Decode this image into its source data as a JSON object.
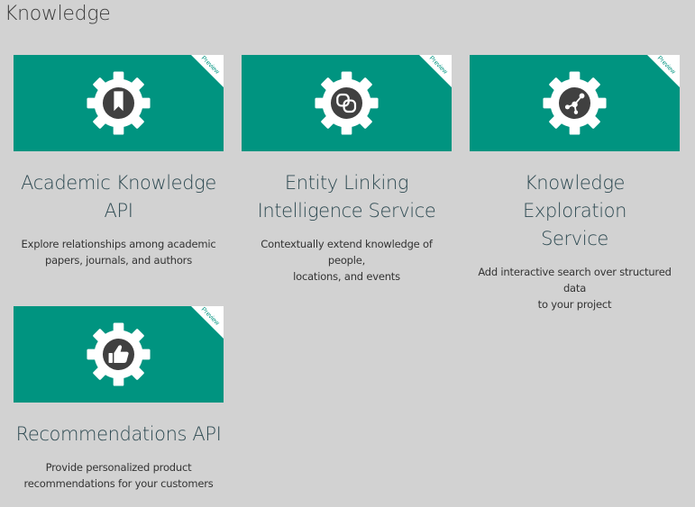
{
  "section": {
    "title": "Knowledge"
  },
  "badge_label": "Preview",
  "colors": {
    "tile": "#009480",
    "background": "#d2d2d2",
    "title": "#2e4a52"
  },
  "cards": [
    {
      "title_line1": "Academic Knowledge",
      "title_line2": "API",
      "desc_line1": "Explore relationships among academic",
      "desc_line2": "papers, journals, and authors",
      "icon": "gear-bookmark-icon"
    },
    {
      "title_line1": "Entity Linking",
      "title_line2": "Intelligence Service",
      "desc_line1": "Contextually extend knowledge of people,",
      "desc_line2": "locations, and events",
      "icon": "gear-linked-circles-icon"
    },
    {
      "title_line1": "Knowledge Exploration",
      "title_line2": "Service",
      "desc_line1": "Add interactive search over structured data",
      "desc_line2": "to your project",
      "icon": "gear-nodes-icon"
    },
    {
      "title_line1": "Recommendations API",
      "title_line2": "",
      "desc_line1": "Provide personalized product",
      "desc_line2": "recommendations for your customers",
      "icon": "gear-thumbs-up-icon"
    }
  ]
}
